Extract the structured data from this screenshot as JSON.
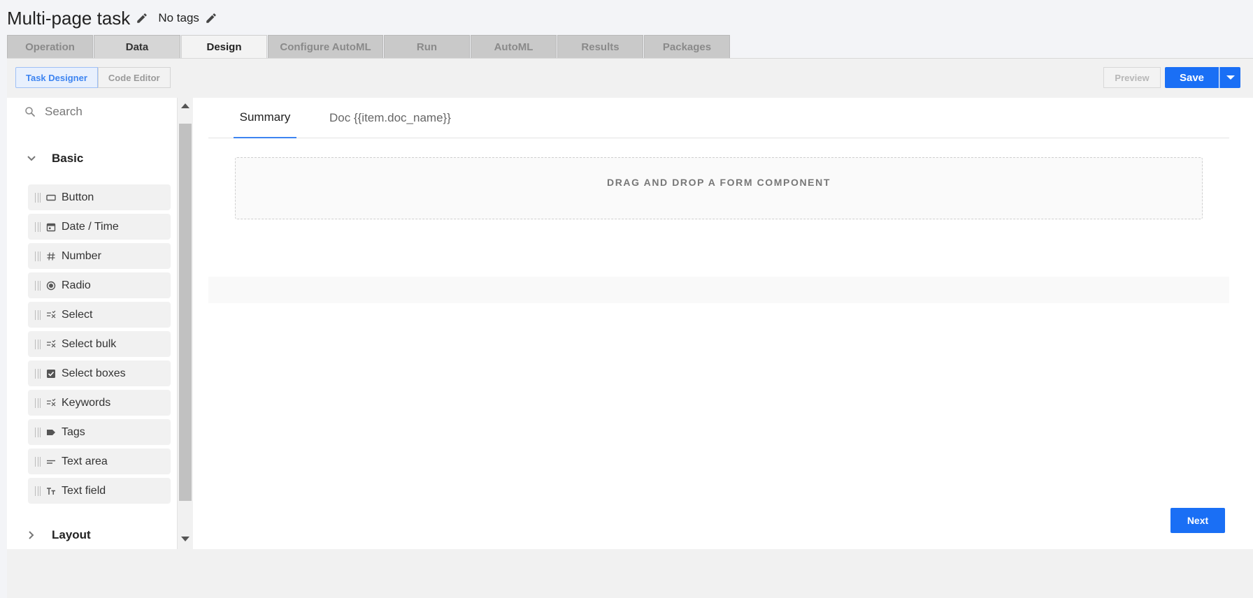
{
  "header": {
    "title": "Multi-page task",
    "tags": "No tags"
  },
  "tabs": [
    {
      "label": "Operation"
    },
    {
      "label": "Data"
    },
    {
      "label": "Design"
    },
    {
      "label": "Configure AutoML"
    },
    {
      "label": "Run"
    },
    {
      "label": "AutoML"
    },
    {
      "label": "Results"
    },
    {
      "label": "Packages"
    }
  ],
  "toolbar": {
    "task_designer": "Task Designer",
    "code_editor": "Code Editor",
    "preview": "Preview",
    "save": "Save"
  },
  "sidebar": {
    "search_placeholder": "Search",
    "groups": [
      {
        "label": "Basic"
      },
      {
        "label": "Layout"
      }
    ],
    "components": [
      {
        "label": "Button",
        "icon": "button-icon"
      },
      {
        "label": "Date / Time",
        "icon": "calendar-icon"
      },
      {
        "label": "Number",
        "icon": "hash-icon"
      },
      {
        "label": "Radio",
        "icon": "radio-icon"
      },
      {
        "label": "Select",
        "icon": "select-icon"
      },
      {
        "label": "Select bulk",
        "icon": "select-icon"
      },
      {
        "label": "Select boxes",
        "icon": "checkbox-icon"
      },
      {
        "label": "Keywords",
        "icon": "select-icon"
      },
      {
        "label": "Tags",
        "icon": "tag-icon"
      },
      {
        "label": "Text area",
        "icon": "textarea-icon"
      },
      {
        "label": "Text field",
        "icon": "textfield-icon"
      }
    ]
  },
  "canvas": {
    "page_tabs": [
      {
        "label": "Summary"
      },
      {
        "label": "Doc {{item.doc_name}}"
      }
    ],
    "dropzone_label": "DRAG AND DROP A FORM COMPONENT"
  },
  "footer": {
    "next": "Next"
  },
  "colors": {
    "primary": "#1a6ff5",
    "tab_active_underline": "#3d84f1"
  }
}
